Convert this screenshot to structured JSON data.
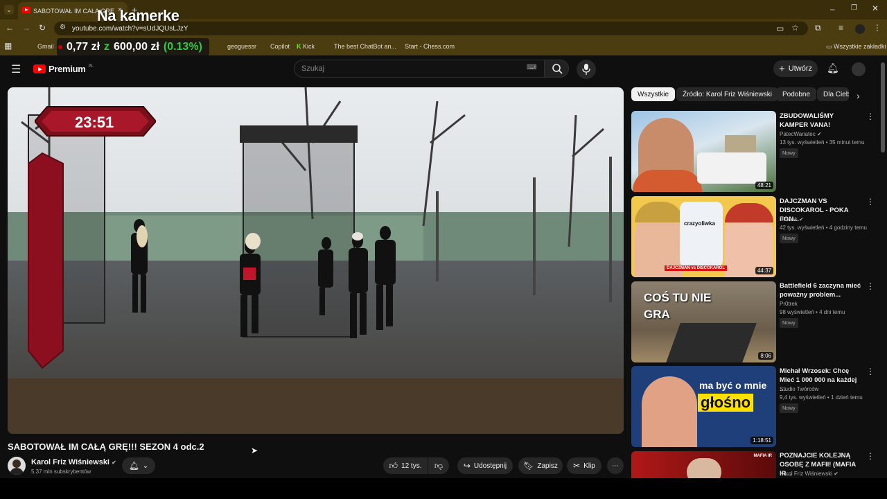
{
  "browser": {
    "tab_title": "SABOTOWAŁ IM CAŁĄ GRĘ",
    "url": "youtube.com/watch?v=sUdJQUsLJzY",
    "bookmarks": [
      "Gmail",
      "geoguessr",
      "Copilot",
      "Kick",
      "The best ChatBot an...",
      "Start - Chess.com"
    ],
    "all_bookmarks": "Wszystkie zakładki",
    "add_tab": "+"
  },
  "overlay": {
    "title": "Na kamerke",
    "price": "0,77 zł",
    "z": "z",
    "target": "600,00 zł",
    "percent": "(0.13%)"
  },
  "youtube": {
    "logo": "Premium",
    "logo_sup": "PL",
    "search_placeholder": "Szukaj",
    "create": "Utwórz"
  },
  "video": {
    "timer": "23:51",
    "title": "SABOTOWAŁ IM CAŁĄ GRĘ!!! SEZON 4 odc.2",
    "channel": "Karol Friz Wiśniewski",
    "subscribers": "5,37 mln subskrybentów",
    "likes": "12 tys.",
    "share": "Udostępnij",
    "save": "Zapisz",
    "clip": "Klip"
  },
  "chips": [
    "Wszystkie",
    "Źródło: Karol Friz Wiśniewski",
    "Podobne",
    "Dla Ciebie"
  ],
  "recommendations": [
    {
      "title": "ZBUDOWALIŚMY KAMPER VANA!",
      "channel": "PatecWariatec",
      "views": "13 tys. wyświetleń",
      "age": "35 minut temu",
      "badge": "Nowy",
      "duration": "48:21",
      "thumb_color": "#6aa0c8"
    },
    {
      "title": "DAJCZMAN VS DISCOKAROL - POKA FON...",
      "channel": "Blowek",
      "views": "42 tys. wyświetleń",
      "age": "4 godziny temu",
      "badge": "Nowy",
      "duration": "44:37",
      "thumb_color": "#f2c94c",
      "thumb_text": "crazyoliwka",
      "thumb_caption": "DAJCZMAN vs DISCOKAROL"
    },
    {
      "title": "Battlefield 6 zaczyna mieć poważny problem...",
      "channel": "Pr0trek",
      "views": "98 wyświetleń",
      "age": "4 dni temu",
      "badge": "Nowy",
      "duration": "8:06",
      "thumb_color": "#7a6a55",
      "thumb_text": "COŚ TU NIE GRA"
    },
    {
      "title": "Michał Wrzosek: Chcę Mieć 1 000 000 na każdej ...",
      "channel": "Studio Twórców",
      "views": "9,4 tys. wyświetleń",
      "age": "1 dzień temu",
      "badge": "Nowy",
      "duration": "1:18:51",
      "thumb_color": "#1e3a6e",
      "thumb_text": "ma być o mnie",
      "thumb_text2": "głośno"
    },
    {
      "title": "POZNAJCIE KOLEJNĄ OSOBĘ Z MAFII! (MAFIA IR...",
      "channel": "Karol Friz Wiśniewski",
      "thumb_color": "#8a1a1a",
      "thumb_text": "MAFIA IR"
    }
  ]
}
